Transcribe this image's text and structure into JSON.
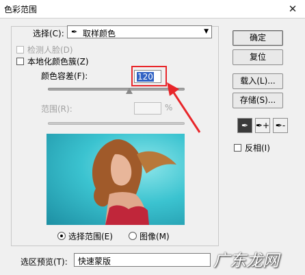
{
  "window": {
    "title": "色彩范围",
    "close": "✕"
  },
  "select": {
    "label": "选择(C):",
    "icon": "✒",
    "value": "取样颜色"
  },
  "options": {
    "detect_faces": "检测人脸(D)",
    "localized_clusters": "本地化颜色簇(Z)"
  },
  "fuzziness": {
    "label": "颜色容差(F):",
    "value": "120",
    "level": 0.5
  },
  "range": {
    "label": "范围(R):",
    "value": "",
    "unit": "%"
  },
  "view": {
    "selection": "选择范围(E)",
    "image": "图像(M)"
  },
  "preview": {
    "label": "选区预览(T):",
    "value": "快速蒙版"
  },
  "buttons": {
    "ok": "确定",
    "reset": "复位",
    "load": "载入(L)...",
    "save": "存储(S)..."
  },
  "tools": {
    "eyedropper": "✒",
    "add": "✒+",
    "subtract": "✒-"
  },
  "invert": {
    "label": "反相(I)"
  },
  "watermark": {
    "text": "广东龙网"
  },
  "colors": {
    "highlight_box": "#e8262a",
    "value_bg": "#3062c4",
    "preview_bg": "#3bc3d0"
  }
}
